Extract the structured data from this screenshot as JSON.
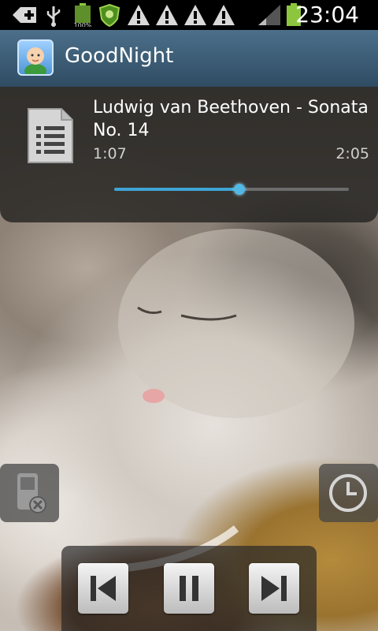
{
  "status_bar": {
    "time": "23:04",
    "battery_level_percent": 100,
    "icons": [
      "add-notification-icon",
      "usb-icon",
      "battery-full-icon",
      "antivirus-shield-icon",
      "warning-icon",
      "warning-icon",
      "warning-icon",
      "warning-icon",
      "signal-icon",
      "battery-charging-icon"
    ],
    "battery_color": "#8cc63f"
  },
  "app_bar": {
    "title": "GoodNight",
    "icon": "baby-face-icon"
  },
  "now_playing": {
    "title": "Ludwig van Beethoven - Sonata No. 14",
    "elapsed": "1:07",
    "duration": "2:05",
    "progress_fraction": 0.535,
    "icon": "document-list-icon"
  },
  "side_controls": {
    "left_icon": "phone-off-icon",
    "right_icon": "clock-timer-icon"
  },
  "playback_controls": {
    "previous_icon": "skip-previous-icon",
    "pause_icon": "pause-icon",
    "next_icon": "skip-next-icon"
  },
  "colors": {
    "accent": "#3fa4d4",
    "app_bar": "#3e5e77"
  }
}
